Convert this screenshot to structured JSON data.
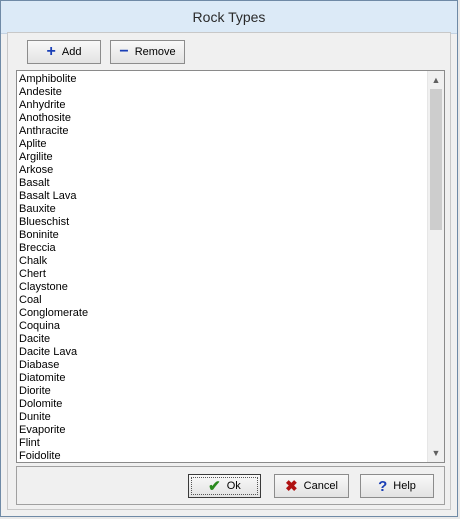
{
  "window": {
    "title": "Rock Types"
  },
  "toolbar": {
    "add_label": "Add",
    "add_icon": "plus-icon",
    "remove_label": "Remove",
    "remove_icon": "minus-icon"
  },
  "list": {
    "items": [
      "Amphibolite",
      "Andesite",
      "Anhydrite",
      "Anothosite",
      "Anthracite",
      "Aplite",
      "Argilite",
      "Arkose",
      "Basalt",
      "Basalt Lava",
      "Bauxite",
      "Blueschist",
      "Boninite",
      "Breccia",
      "Chalk",
      "Chert",
      "Claystone",
      "Coal",
      "Conglomerate",
      "Coquina",
      "Dacite",
      "Dacite Lava",
      "Diabase",
      "Diatomite",
      "Diorite",
      "Dolomite",
      "Dunite",
      "Evaporite",
      "Flint",
      "Foidolite"
    ]
  },
  "footer": {
    "ok_label": "Ok",
    "ok_icon": "checkmark-icon",
    "cancel_label": "Cancel",
    "cancel_icon": "x-icon",
    "help_label": "Help",
    "help_icon": "question-icon"
  },
  "colors": {
    "accent_blue": "#1a3fb6",
    "ok_green": "#2a8a1e",
    "cancel_red": "#b01212"
  }
}
